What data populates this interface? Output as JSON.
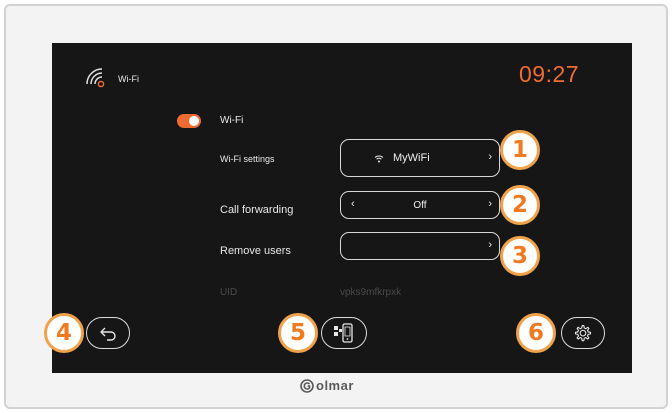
{
  "header": {
    "title": "Wi-Fi",
    "time": "09:27"
  },
  "wifi_toggle": {
    "label": "Wi-Fi",
    "state": "on"
  },
  "settings": {
    "wifi_settings_label": "Wi-Fi settings",
    "wifi_network": "MyWiFi",
    "call_forwarding_label": "Call forwarding",
    "call_forwarding_value": "Off",
    "remove_users_label": "Remove users",
    "remove_users_value": "",
    "uid_label": "UID",
    "uid_value": "vpks9mfkrpxk"
  },
  "chevrons": {
    "left": "‹",
    "right": "›"
  },
  "badges": [
    "1",
    "2",
    "3",
    "4",
    "5",
    "6"
  ],
  "footer": {
    "brand": "olmar"
  },
  "icons": {
    "header": "wifi-signal-icon",
    "network": "wifi-icon",
    "back": "back-arrow-icon",
    "device": "qr-phone-icon",
    "settings": "gear-icon",
    "logo": "golmar-logo-icon"
  },
  "colors": {
    "accent": "#f06b32",
    "screen": "#161616",
    "badge_ring": "#f0a24a"
  }
}
